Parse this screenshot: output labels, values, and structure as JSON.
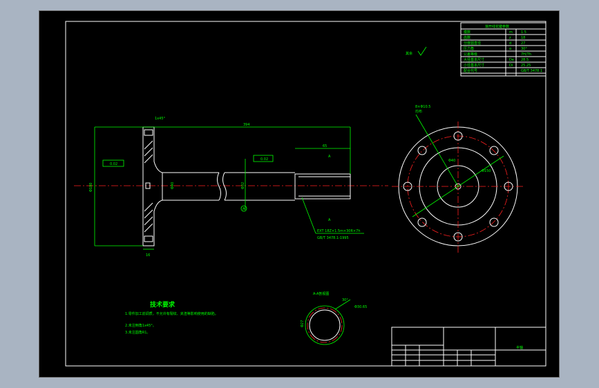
{
  "drawing": {
    "title_block_name": "半轴",
    "tech_req": {
      "heading": "技术要求",
      "items": [
        "1.零件加工前调质，不允许有裂纹、夹渣等影响使用的缺陷。",
        "2.未注倒角1x45°。",
        "3.未注圆角R1。"
      ]
    },
    "section_label": "A-A剖视图",
    "section_dims": [
      "Φ30.65",
      "Φ27",
      "30°"
    ],
    "param_table": {
      "title": "渐开线花键参数",
      "rows": [
        [
          "模数",
          "m",
          "1.5"
        ],
        [
          "齿数",
          "z",
          "18"
        ],
        [
          "分度圆直径",
          "d",
          "27"
        ],
        [
          "压力角",
          "α",
          "30°"
        ],
        [
          "公差等级",
          "",
          "7H/7h"
        ],
        [
          "大径基本尺寸",
          "De",
          "28.5"
        ],
        [
          "小径基本尺寸",
          "Di",
          "25.25"
        ],
        [
          "配合代号",
          "",
          "GB/T 3478.1"
        ]
      ]
    },
    "roughness_note": "其余",
    "dims_side": {
      "overall_length": "394",
      "spline_length": "65",
      "flange_dia": "Φ180",
      "shaft_dia": "Φ40",
      "mid_dia": "Φ32",
      "flange_thk": "16",
      "chamfer": "1x45°",
      "tol_runout": "0.02",
      "tol_perp": "0.02",
      "datum": "A",
      "section_mark": "A",
      "spline_callout_1": "EXT 18Z×1.5m×30R×7h",
      "spline_callout_2": "GB/T 3478.1-1995"
    },
    "dims_end": {
      "holes": "8×Φ10.5",
      "hole_note": "均布",
      "pcd": "Φ150",
      "bore": "Φ40"
    }
  }
}
